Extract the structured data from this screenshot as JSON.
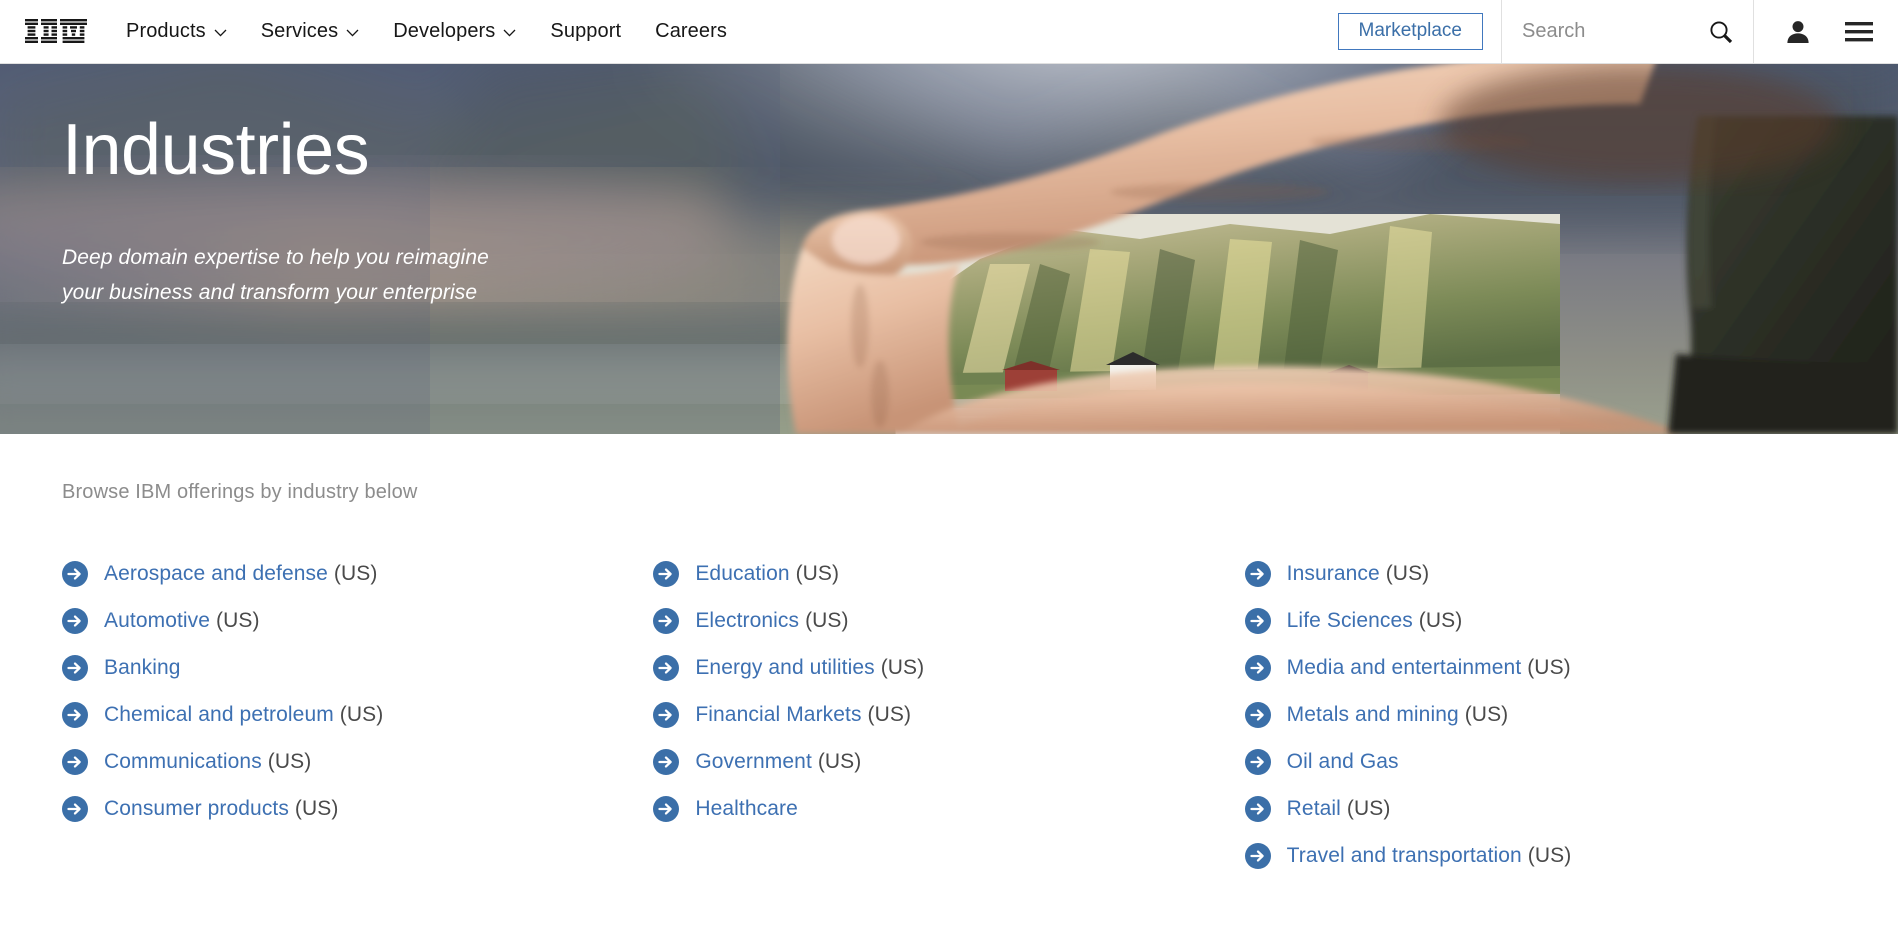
{
  "masthead": {
    "logo_alt": "IBM",
    "nav": [
      {
        "label": "Products",
        "has_dropdown": true
      },
      {
        "label": "Services",
        "has_dropdown": true
      },
      {
        "label": "Developers",
        "has_dropdown": true
      },
      {
        "label": "Support",
        "has_dropdown": false
      },
      {
        "label": "Careers",
        "has_dropdown": false
      }
    ],
    "marketplace_label": "Marketplace",
    "search_placeholder": "Search",
    "search_value": "",
    "icons": {
      "search": "search-icon",
      "account": "user-account-icon",
      "menu": "hamburger-menu-icon"
    }
  },
  "hero": {
    "title": "Industries",
    "subtitle": "Deep domain expertise to help you reimagine your business and transform your enterprise",
    "image_alt": "Hands framing a fjord landscape with mountains, a white house and a red barn beside water"
  },
  "main": {
    "browse_label": "Browse IBM offerings by industry below",
    "columns": [
      {
        "items": [
          {
            "name": "Aerospace and defense",
            "suffix": " (US)"
          },
          {
            "name": "Automotive",
            "suffix": " (US)"
          },
          {
            "name": "Banking",
            "suffix": ""
          },
          {
            "name": "Chemical and petroleum",
            "suffix": " (US)"
          },
          {
            "name": "Communications",
            "suffix": " (US)"
          },
          {
            "name": "Consumer products",
            "suffix": " (US)"
          }
        ]
      },
      {
        "items": [
          {
            "name": "Education",
            "suffix": " (US)"
          },
          {
            "name": "Electronics",
            "suffix": " (US)"
          },
          {
            "name": "Energy and utilities",
            "suffix": " (US)"
          },
          {
            "name": "Financial Markets",
            "suffix": " (US)"
          },
          {
            "name": "Government",
            "suffix": " (US)"
          },
          {
            "name": "Healthcare",
            "suffix": ""
          }
        ]
      },
      {
        "items": [
          {
            "name": "Insurance",
            "suffix": " (US)"
          },
          {
            "name": "Life Sciences",
            "suffix": " (US)"
          },
          {
            "name": "Media and entertainment",
            "suffix": " (US)"
          },
          {
            "name": "Metals and mining",
            "suffix": " (US)"
          },
          {
            "name": "Oil and Gas",
            "suffix": ""
          },
          {
            "name": "Retail",
            "suffix": " (US)"
          },
          {
            "name": "Travel and transportation",
            "suffix": " (US)"
          }
        ]
      }
    ]
  },
  "colors": {
    "link_blue": "#3d70b2",
    "arrow_circle": "#3b6fa8",
    "marketplace_border": "#4178be",
    "text_dark": "#171717",
    "muted": "#8c8c8c"
  }
}
